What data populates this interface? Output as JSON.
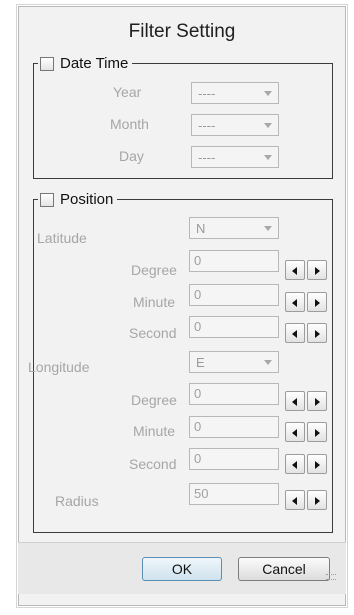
{
  "dialog": {
    "title": "Filter Setting"
  },
  "date_time": {
    "label": "Date Time",
    "checked": false,
    "rows": [
      {
        "label": "Year",
        "value": "----"
      },
      {
        "label": "Month",
        "value": "----"
      },
      {
        "label": "Day",
        "value": "----"
      }
    ]
  },
  "position": {
    "label": "Position",
    "checked": false,
    "latitude": {
      "label": "Latitude",
      "direction": "N",
      "degree_label": "Degree",
      "degree_value": "0",
      "minute_label": "Minute",
      "minute_value": "0",
      "second_label": "Second",
      "second_value": "0"
    },
    "longitude": {
      "label": "Longitude",
      "direction": "E",
      "degree_label": "Degree",
      "degree_value": "0",
      "minute_label": "Minute",
      "minute_value": "0",
      "second_label": "Second",
      "second_value": "0"
    },
    "radius": {
      "label": "Radius",
      "value": "50"
    }
  },
  "footer": {
    "ok_label": "OK",
    "cancel_label": "Cancel"
  },
  "icons": {
    "combo_arrow": "chevron-down-icon",
    "spin_left": "arrow-left-icon",
    "spin_right": "arrow-right-icon"
  }
}
